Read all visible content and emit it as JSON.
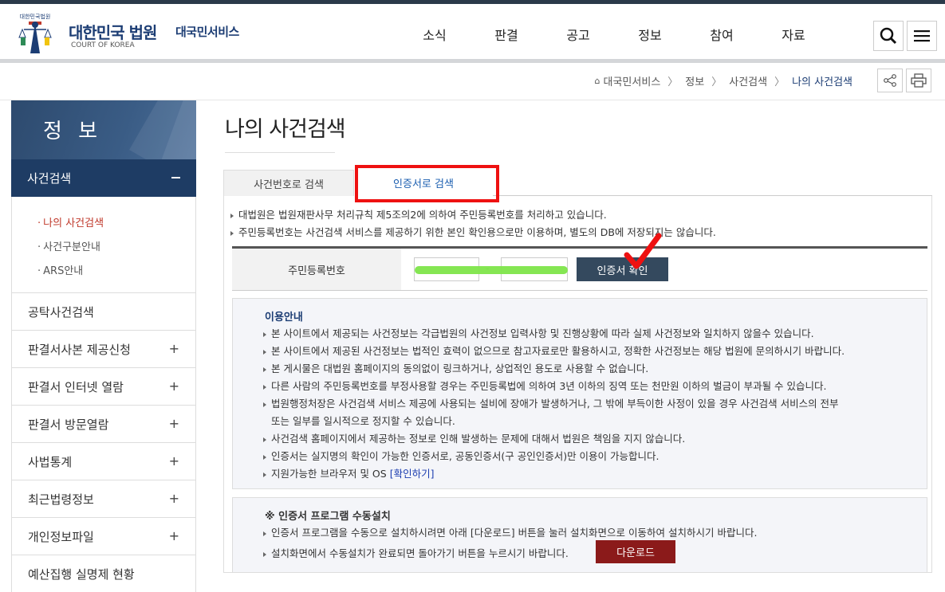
{
  "header": {
    "logo_small": "대한민국법원",
    "title": "대한민국 법원",
    "subtitle": "COURT OF KOREA",
    "service": "대국민서비스",
    "nav": [
      "소식",
      "판결",
      "공고",
      "정보",
      "참여",
      "자료"
    ],
    "search_icon": "search-icon",
    "menu_icon": "hamburger-icon"
  },
  "breadcrumb": {
    "items": [
      "대국민서비스",
      "정보",
      "사건검색",
      "나의 사건검색"
    ]
  },
  "sidebar": {
    "title": "정 보",
    "active": "사건검색",
    "sub_items": [
      "나의 사건검색",
      "사건구분안내",
      "ARS안내"
    ],
    "items": [
      {
        "label": "공탁사건검색",
        "expandable": false
      },
      {
        "label": "판결서사본 제공신청",
        "expandable": true
      },
      {
        "label": "판결서 인터넷 열람",
        "expandable": true
      },
      {
        "label": "판결서 방문열람",
        "expandable": true
      },
      {
        "label": "사법통계",
        "expandable": true
      },
      {
        "label": "최근법령정보",
        "expandable": true
      },
      {
        "label": "개인정보파일",
        "expandable": true
      },
      {
        "label": "예산집행 실명제 현황",
        "expandable": false
      }
    ]
  },
  "main": {
    "title": "나의 사건검색",
    "tabs": [
      "사건번호로 검색",
      "인증서로 검색"
    ],
    "notices": [
      "대법원은 법원재판사무 처리규칙 제5조의2에 의하여 주민등록번호를 처리하고 있습니다.",
      "주민등록번호는 사건검색 서비스를 제공하기 위한 본인 확인용으로만 이용하며, 별도의 DB에 저장되지는 않습니다."
    ],
    "id_label": "주민등록번호",
    "id_dash": "-",
    "cert_button": "인증서 확인",
    "guide": {
      "title": "이용안내",
      "lines": [
        "본 사이트에서 제공되는 사건정보는 각급법원의 사건정보 입력사항 및 진행상황에 따라 실제 사건정보와 일치하지 않을수 있습니다.",
        "본 사이트에서 제공된 사건정보는 법적인 효력이 없으므로 참고자료로만 활용하시고, 정확한 사건정보는 해당 법원에 문의하시기 바랍니다.",
        "본 게시물은 대법원 홈페이지의 동의없이 링크하거나, 상업적인 용도로 사용할 수 없습니다.",
        "다른 사람의 주민등록번호를 부정사용할 경우는 주민등록법에 의하여 3년 이하의 징역 또는 천만원 이하의 벌금이 부과될 수 있습니다.",
        "법원행정처장은 사건검색 서비스 제공에 사용되는 설비에 장애가 발생하거나, 그 밖에 부득이한 사정이 있을 경우 사건검색 서비스의 전부",
        "또는 일부를 일시적으로 정지할 수 있습니다.",
        "사건검색 홈페이지에서 제공하는 정보로 인해 발생하는 문제에 대해서 법원은 책임을 지지 않습니다.",
        "인증서는 실지명의 확인이 가능한 인증서로, 공동인증서(구 공인인증서)만 이용이 가능합니다.",
        "지원가능한 브라우저 및 OS"
      ],
      "link": "[확인하기]"
    },
    "install": {
      "title": "※ 인증서 프로그램 수동설치",
      "lines": [
        "인증서 프로그램을 수동으로 설치하시려면 아래 [다운로드] 버튼을 눌러 설치화면으로 이동하여 설치하시기 바랍니다.",
        "설치화면에서 수동설치가 완료되면 돌아가기 버튼을 누르시기 바랍니다."
      ],
      "download": "다운로드"
    }
  },
  "colors": {
    "brand": "#1c3d74",
    "sidebar_active": "#1e3c64",
    "highlight_box": "#ee1111",
    "annotation_check": "#ee1111",
    "redacted_mark": "#7ee54a",
    "download_button": "#8b1a1a"
  }
}
